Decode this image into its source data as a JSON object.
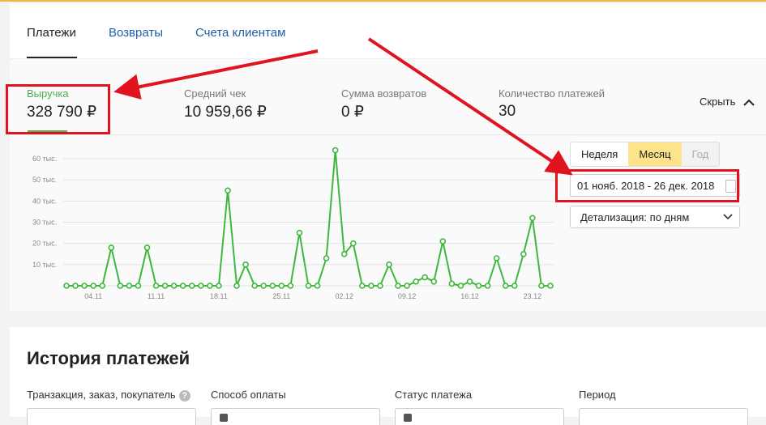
{
  "tabs": [
    {
      "label": "Платежи",
      "active": true
    },
    {
      "label": "Возвраты",
      "active": false
    },
    {
      "label": "Счета клиентам",
      "active": false
    }
  ],
  "metrics": [
    {
      "label": "Выручка",
      "value": "328 790 ₽",
      "active": true
    },
    {
      "label": "Средний чек",
      "value": "10 959,66 ₽",
      "active": false
    },
    {
      "label": "Сумма возвратов",
      "value": "0 ₽",
      "active": false
    },
    {
      "label": "Количество платежей",
      "value": "30",
      "active": false
    }
  ],
  "hide_label": "Скрыть",
  "period_buttons": [
    {
      "label": "Неделя",
      "state": "normal"
    },
    {
      "label": "Месяц",
      "state": "selected"
    },
    {
      "label": "Год",
      "state": "disabled"
    }
  ],
  "date_range": "01 нояб. 2018 - 26 дек. 2018",
  "detail_select": "Детализация: по дням",
  "history_title": "История платежей",
  "filters": [
    {
      "label": "Транзакция, заказ, покупатель",
      "help": "?"
    },
    {
      "label": "Способ оплаты"
    },
    {
      "label": "Статус платежа"
    },
    {
      "label": "Период"
    }
  ],
  "colors": {
    "accent_green": "#3db83d",
    "annotation_red": "#e0131f",
    "link_blue": "#1f5fad",
    "selected_yellow": "#fde38a"
  },
  "chart_data": {
    "type": "line",
    "ylim": [
      0,
      65
    ],
    "y_ticks": [
      {
        "value": 10,
        "label": "10 тыс."
      },
      {
        "value": 20,
        "label": "20 тыс."
      },
      {
        "value": 30,
        "label": "30 тыс."
      },
      {
        "value": 40,
        "label": "40 тыс."
      },
      {
        "value": 50,
        "label": "50 тыс."
      },
      {
        "value": 60,
        "label": "60 тыс."
      }
    ],
    "x_ticks": [
      {
        "index": 3,
        "label": "04.11"
      },
      {
        "index": 10,
        "label": "11.11"
      },
      {
        "index": 17,
        "label": "18.11"
      },
      {
        "index": 24,
        "label": "25.11"
      },
      {
        "index": 31,
        "label": "02.12"
      },
      {
        "index": 38,
        "label": "09.12"
      },
      {
        "index": 45,
        "label": "16.12"
      },
      {
        "index": 52,
        "label": "23.12"
      }
    ],
    "values": [
      0,
      0,
      0,
      0,
      0,
      18,
      0,
      0,
      0,
      18,
      0,
      0,
      0,
      0,
      0,
      0,
      0,
      0,
      45,
      0,
      10,
      0,
      0,
      0,
      0,
      0,
      25,
      0,
      0,
      13,
      64,
      15,
      20,
      0,
      0,
      0,
      10,
      0,
      0,
      2,
      4,
      2,
      21,
      1,
      0,
      2,
      0,
      0,
      13,
      0,
      0,
      15,
      32,
      0,
      0
    ]
  }
}
